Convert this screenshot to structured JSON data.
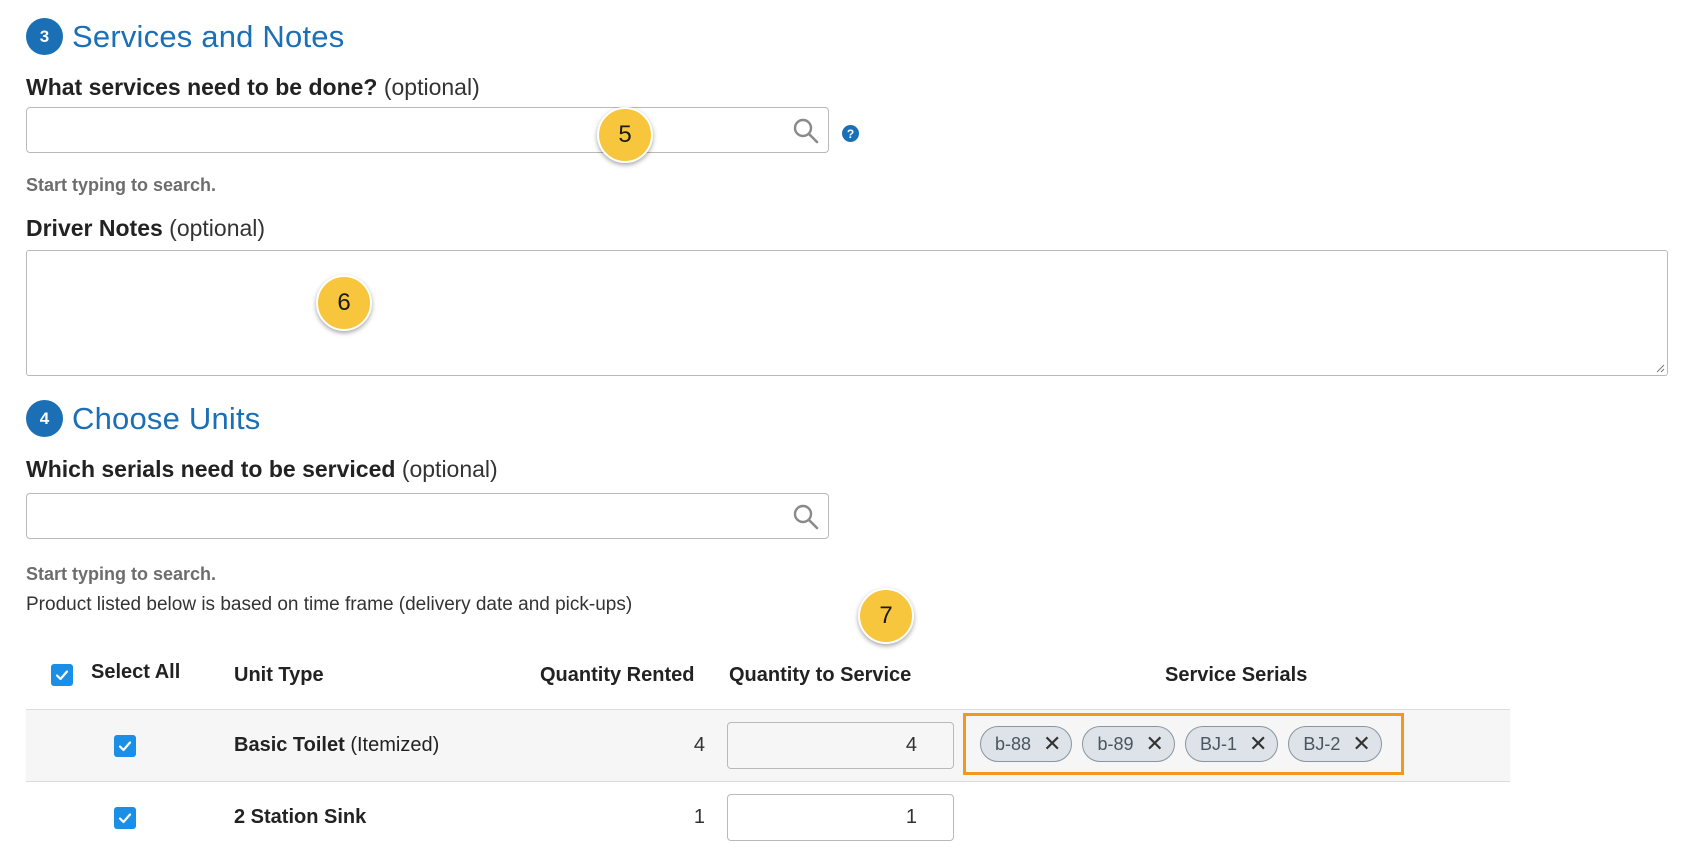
{
  "section3": {
    "number": "3",
    "title": "Services and Notes"
  },
  "services": {
    "label": "What services need to be done?",
    "optional": "(optional)",
    "value": "",
    "placeholder": "",
    "hint": "Start typing to search.",
    "help": "?"
  },
  "driver_notes": {
    "label": "Driver Notes",
    "optional": "(optional)",
    "value": ""
  },
  "section4": {
    "number": "4",
    "title": "Choose Units"
  },
  "serials": {
    "label": "Which serials need to be serviced",
    "optional": "(optional)",
    "value": "",
    "placeholder": "",
    "hint": "Start typing to search.",
    "note": "Product listed below is based on time frame (delivery date and pick-ups)"
  },
  "callouts": [
    "5",
    "6",
    "7"
  ],
  "table": {
    "headers": {
      "select_all": "Select All",
      "unit_type": "Unit Type",
      "qty_rented": "Quantity Rented",
      "qty_service": "Quantity to Service",
      "service_serials": "Service Serials"
    },
    "rows": [
      {
        "name": "Basic Toilet",
        "suffix": "(Itemized)",
        "rented": "4",
        "to_service": "4",
        "checked": true,
        "serials": [
          "b-88",
          "b-89",
          "BJ-1",
          "BJ-2"
        ]
      },
      {
        "name": "2 Station Sink",
        "suffix": "",
        "rented": "1",
        "to_service": "1",
        "checked": true,
        "serials": []
      }
    ]
  },
  "colors": {
    "accent": "#1a6fb5",
    "checkbox": "#1b8ee6",
    "callout": "#f8c63d",
    "highlight": "#f5961d"
  }
}
